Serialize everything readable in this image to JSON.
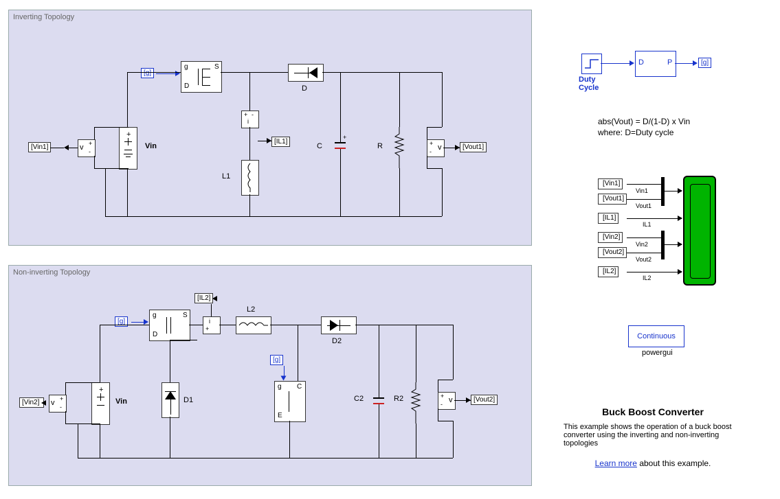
{
  "panels": {
    "inverting": {
      "title": "Inverting Topology"
    },
    "noninverting": {
      "title": "Non-inverting Topology"
    }
  },
  "inverting": {
    "vin_tag": "[Vin1]",
    "vin_label": "Vin",
    "g_tag": "[g]",
    "switch_g": "g",
    "switch_d": "D",
    "switch_s": "S",
    "diode_label": "D",
    "il_tag": "[IL1]",
    "L_label": "L1",
    "C_label": "C",
    "R_label": "R",
    "vout_tag": "[Vout1]",
    "vmeter_plus": "+",
    "vmeter_minus": "-",
    "vmeter_v": "v"
  },
  "noninverting": {
    "vin_tag": "[Vin2]",
    "vin_label": "Vin",
    "g_tag1": "[g]",
    "g_tag2": "[g]",
    "switch1_g": "g",
    "switch1_d": "D",
    "switch1_s": "S",
    "il_tag": "[IL2]",
    "L_label": "L2",
    "D1_label": "D1",
    "D2_label": "D2",
    "C2_label": "C2",
    "R2_label": "R2",
    "vout_tag": "[Vout2]",
    "switch2_g": "g",
    "switch2_c": "C",
    "switch2_e": "E",
    "vmeter_plus": "+",
    "vmeter_minus": "-",
    "vmeter_v": "v"
  },
  "duty": {
    "label": "Duty\nCycle",
    "D": "D",
    "P": "P",
    "out_tag": "[g]"
  },
  "equation": {
    "line1": "abs(Vout) = D/(1-D) x Vin",
    "line2": "where: D=Duty cycle"
  },
  "scope_signals": {
    "s1_tag": "[Vin1]",
    "s1_label": "Vin1",
    "s2_tag": "[Vout1]",
    "s2_label": "Vout1",
    "s3_tag": "[IL1]",
    "s3_label": "IL1",
    "s4_tag": "[Vin2]",
    "s4_label": "Vin2",
    "s5_tag": "[Vout2]",
    "s5_label": "Vout2",
    "s6_tag": "[IL2]",
    "s6_label": "IL2"
  },
  "powergui": {
    "mode": "Continuous",
    "label": "powergui"
  },
  "footer": {
    "title": "Buck Boost Converter",
    "desc": "This example shows the operation of a buck boost converter using the inverting and non-inverting topologies",
    "link_text": "Learn more",
    "link_tail": " about this example."
  }
}
